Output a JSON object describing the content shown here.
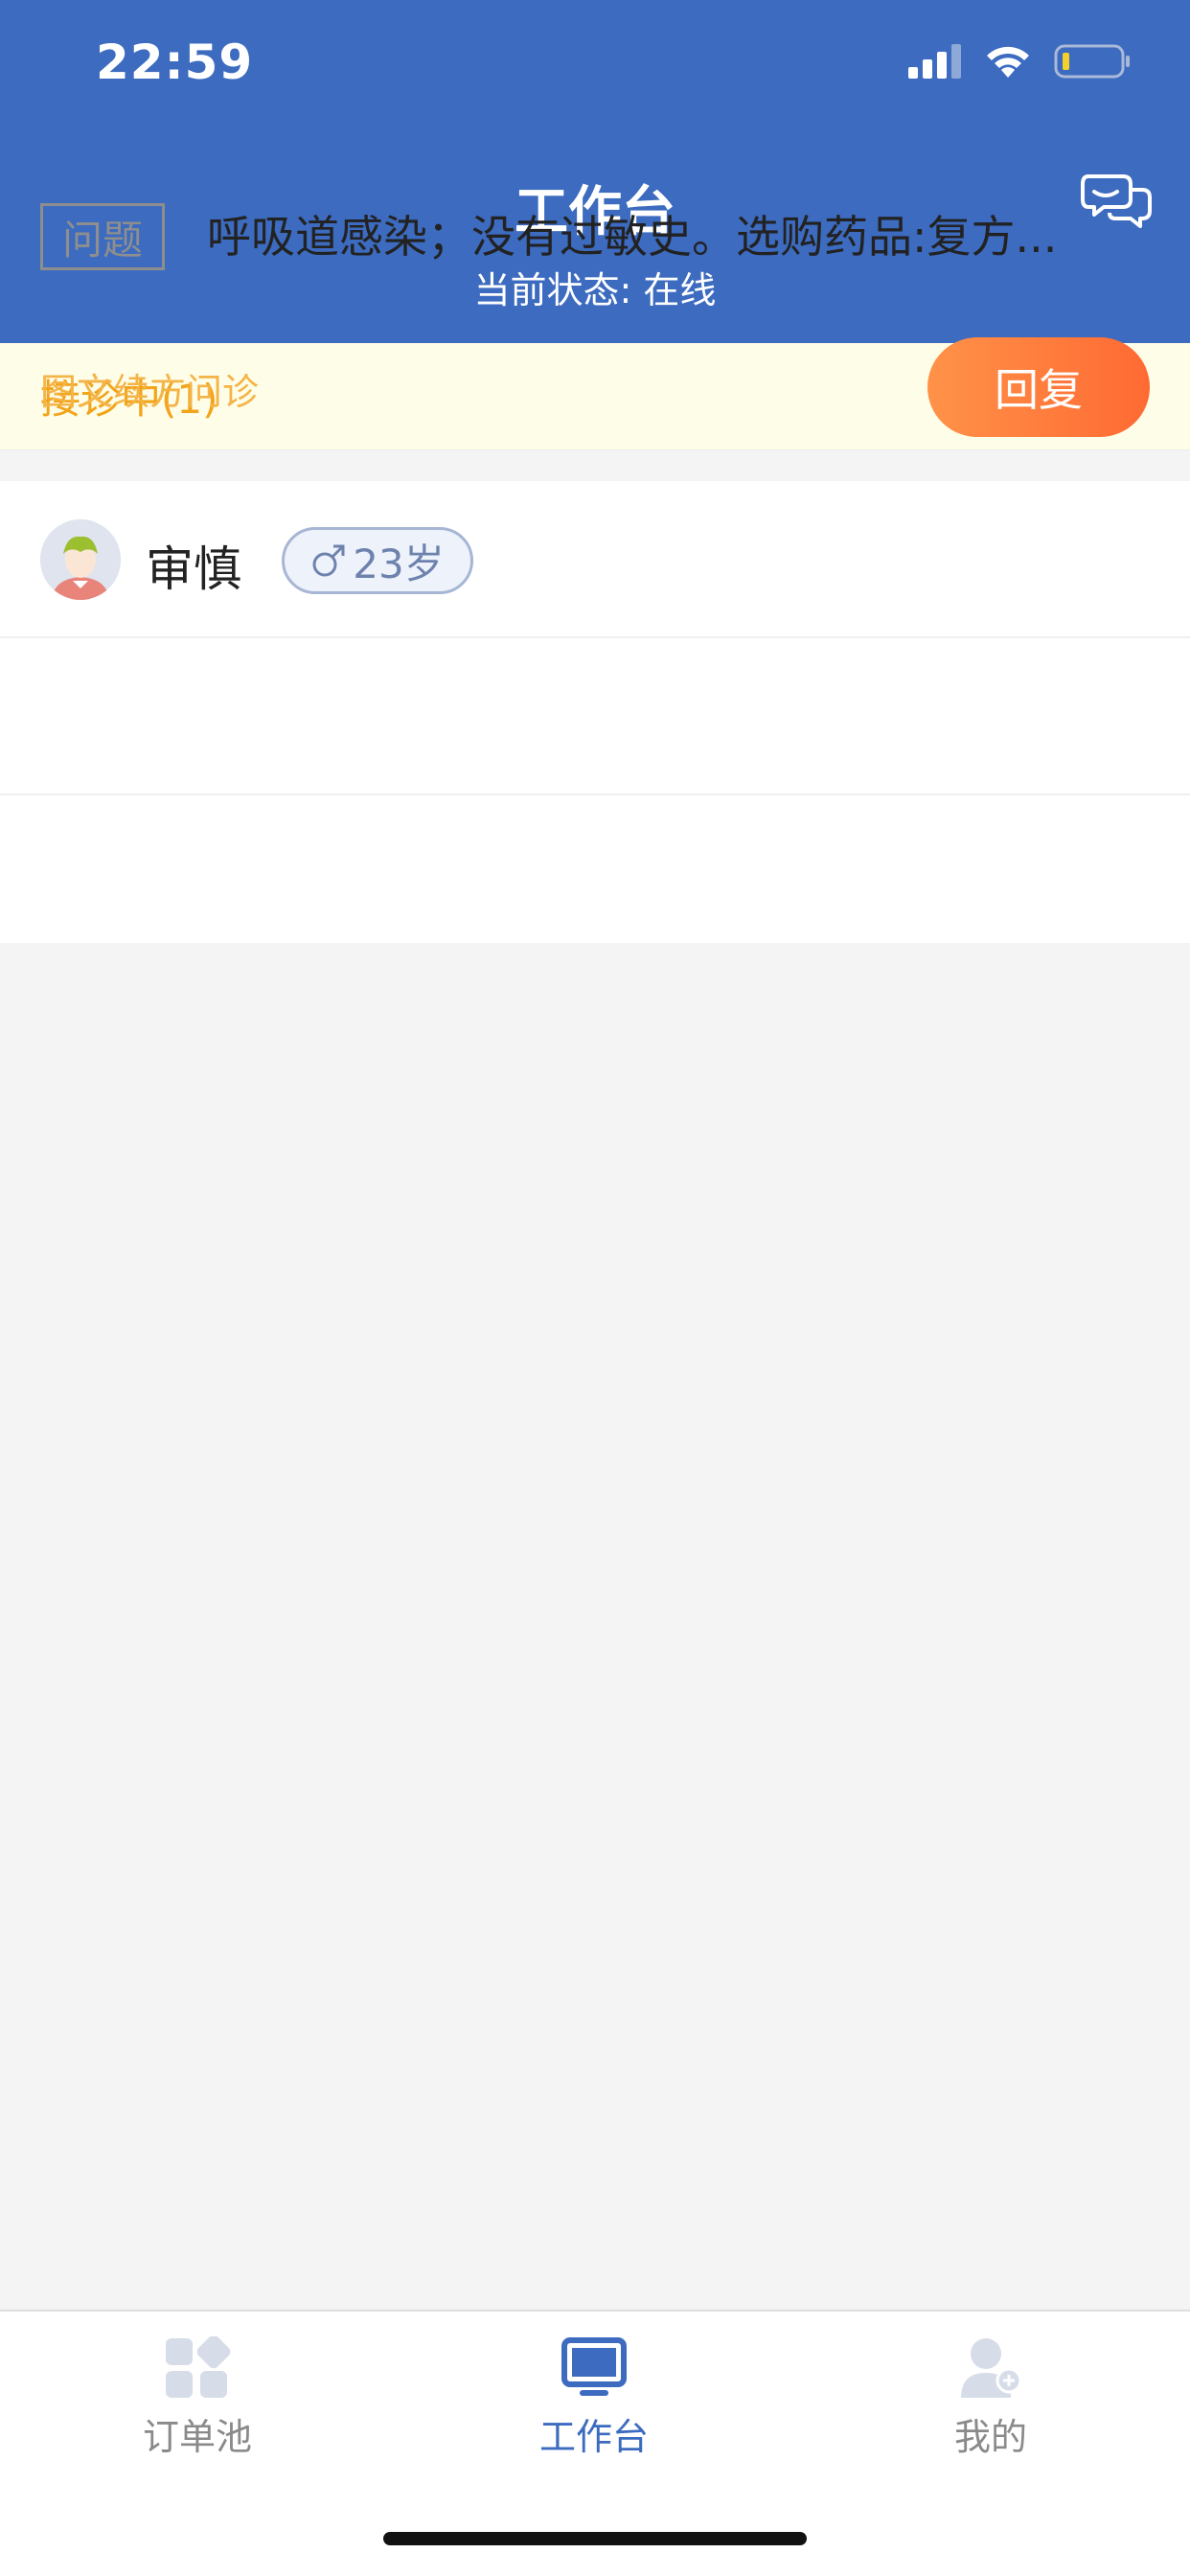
{
  "status_bar": {
    "time": "22:59"
  },
  "header": {
    "title": "工作台",
    "subtitle": "当前状态: 在线",
    "chat_icon": "chat-bubbles-icon"
  },
  "banner": {
    "label": "接诊中(1)"
  },
  "consultation": {
    "patient_name": "审慎",
    "gender_symbol": "♂",
    "age": "23岁",
    "question_tag": "问题",
    "question_text": "呼吸道感染；没有过敏史。选购药品:复方...",
    "service_type": "图文续方问诊",
    "reply_label": "回复"
  },
  "tabbar": {
    "tabs": [
      {
        "label": "订单池",
        "icon": "grid-apps-icon",
        "active": false
      },
      {
        "label": "工作台",
        "icon": "monitor-icon",
        "active": true
      },
      {
        "label": "我的",
        "icon": "user-profile-icon",
        "active": false
      }
    ]
  },
  "colors": {
    "primary": "#3c6bbf",
    "banner_text": "#f2a41a",
    "service_text": "#f4b447",
    "reply_gradient_start": "#ff9248",
    "reply_gradient_end": "#ff6a33"
  }
}
